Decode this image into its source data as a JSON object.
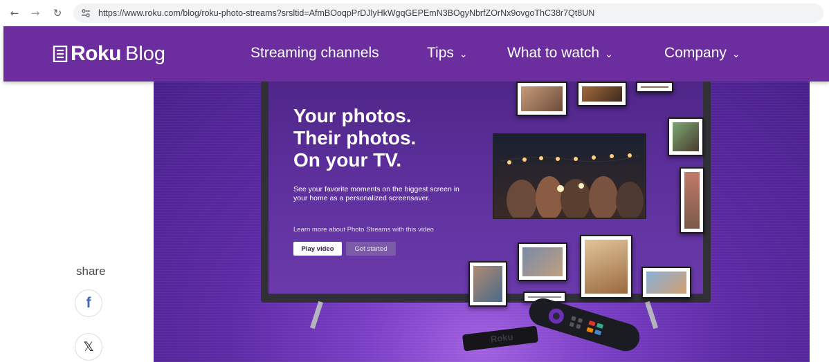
{
  "browser": {
    "url": "https://www.roku.com/blog/roku-photo-streams?srsltid=AfmBOoqpPrDJlyHkWgqGEPEmN3BOgyNbrfZOrNx9ovgoThC38r7Qt8UN",
    "back_icon": "←",
    "forward_icon": "→",
    "reload_icon": "↻"
  },
  "header": {
    "logo_text": "Roku",
    "logo_suffix": "Blog",
    "nav": [
      {
        "label": "Streaming channels",
        "has_dropdown": false
      },
      {
        "label": "Tips",
        "has_dropdown": true
      },
      {
        "label": "What to watch",
        "has_dropdown": true
      },
      {
        "label": "Company",
        "has_dropdown": true
      }
    ],
    "chevron": "⌄"
  },
  "hero": {
    "headline_1": "Your photos.",
    "headline_2": "Their photos.",
    "headline_3": "On your TV.",
    "subtext": "See your favorite moments on the biggest screen in your home as a personalized screensaver.",
    "learn_more": "Learn more about Photo Streams with this video",
    "play_label": "Play video",
    "start_label": "Get started",
    "stick_brand": "Roku"
  },
  "share": {
    "label": "share",
    "facebook_glyph": "f",
    "x_glyph": "𝕏"
  },
  "colors": {
    "brand_purple": "#6c2e9e",
    "hero_purple": "#5c2aa3"
  }
}
